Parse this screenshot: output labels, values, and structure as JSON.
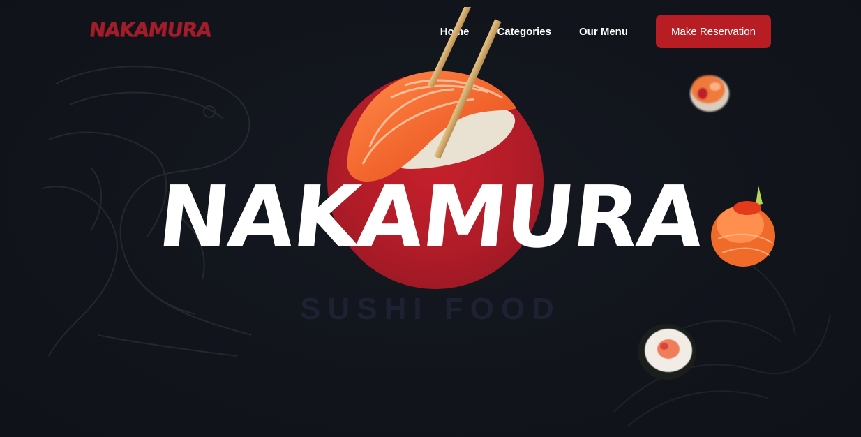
{
  "brand": {
    "logo_text": "NAKAMURA"
  },
  "nav": {
    "items": [
      {
        "label": "Home"
      },
      {
        "label": "Categories"
      },
      {
        "label": "Our Menu"
      }
    ],
    "cta_label": "Make Reservation"
  },
  "hero": {
    "title": "NAKAMURA",
    "subtitle": "SUSHI FOOD"
  },
  "colors": {
    "background": "#11141b",
    "accent": "#b81d24",
    "sun": "#c7202c",
    "logo": "#a11d2a",
    "subtitle": "#1d2131"
  },
  "icons": [
    "sushi-hero-image",
    "sushi-roll-image",
    "salmon-nigiri-image",
    "koi-decoration"
  ]
}
